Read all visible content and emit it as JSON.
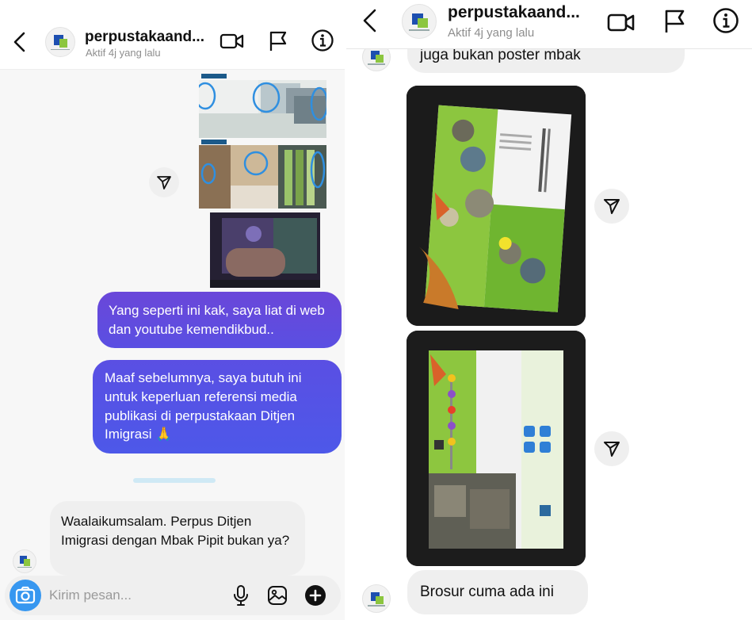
{
  "left_panel": {
    "header": {
      "title": "perpustakaand...",
      "status": "Aktif 4j yang lalu",
      "icons": [
        "back-icon",
        "video-call-icon",
        "flag-icon",
        "info-icon"
      ]
    },
    "messages": [
      {
        "type": "outgoing",
        "text": "Yang seperti ini kak, saya liat di web dan youtube kemendikbud.."
      },
      {
        "type": "outgoing",
        "text": "Maaf sebelumnya, saya butuh ini untuk keperluan referensi media publikasi di perpustakaan Ditjen Imigrasi 🙏"
      },
      {
        "type": "incoming",
        "text": "Waalaikumsalam. Perpus Ditjen Imigrasi dengan Mbak Pipit bukan ya?"
      }
    ],
    "composer": {
      "placeholder": "Kirim pesan...",
      "icons": [
        "camera-icon",
        "microphone-icon",
        "gallery-icon",
        "plus-icon"
      ]
    }
  },
  "right_panel": {
    "header": {
      "title": "perpustakaand...",
      "status": "Aktif 4j yang lalu",
      "icons": [
        "back-icon",
        "video-call-icon",
        "flag-icon",
        "info-icon"
      ]
    },
    "messages": [
      {
        "type": "incoming",
        "text": "juga bukan poster mbak"
      },
      {
        "type": "incoming",
        "text": "Brosur cuma ada ini"
      }
    ],
    "photos": [
      "brochure-front-photo",
      "brochure-inside-photo"
    ]
  },
  "colors": {
    "bubble_gradient_top": "#6b3fd4",
    "bubble_gradient_bottom": "#4e55e6",
    "incoming_bubble": "#efefef",
    "camera_button": "#3797f0"
  }
}
